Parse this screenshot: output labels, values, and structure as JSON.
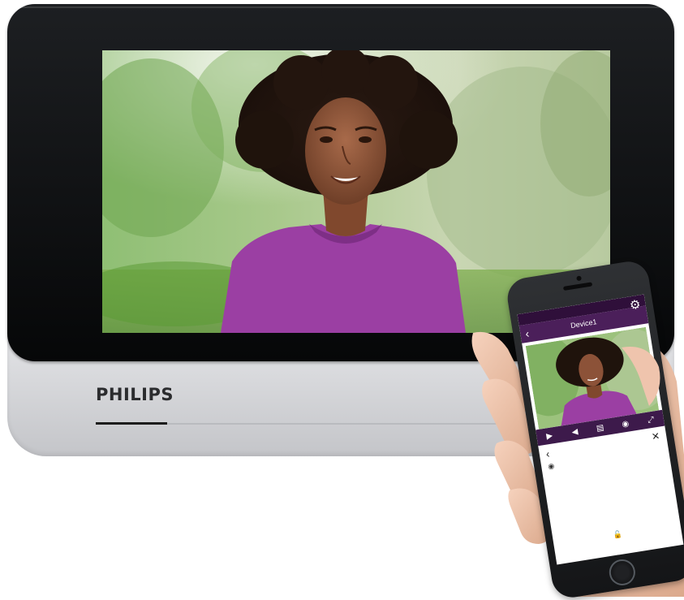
{
  "monitor": {
    "brand": "PHILIPS"
  },
  "phone_app": {
    "device_title": "Device1",
    "back_icon": "chevron-left-icon",
    "settings_icon": "gear-icon",
    "controls": [
      "play-icon",
      "speaker-icon",
      "screenshot-icon",
      "camera-icon",
      "expand-icon"
    ],
    "panel_icons": [
      "chevron-left-icon",
      "close-icon",
      "record-icon",
      "unlock-icon"
    ]
  },
  "colors": {
    "app_purple_dark": "#2f0f3a",
    "app_purple": "#4b1f5a",
    "controls_purple": "#3d1a4b",
    "sweater": "#9b3fa3",
    "bezel": "#0b0c0e",
    "housing": "#dcdde0"
  }
}
